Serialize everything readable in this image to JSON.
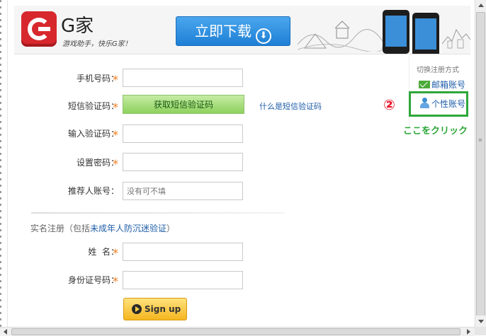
{
  "header": {
    "app_name": "G家",
    "slogan": "游戏助手，快乐G家！",
    "download_button": "立即下载",
    "download_icon": "download-icon",
    "colors": {
      "logo_red": "#d7282d",
      "download_blue": "#2b8de0"
    }
  },
  "form": {
    "phone_label": "手机号码：",
    "sms_label": "短信验证码：",
    "sms_button": "获取短信验证码",
    "sms_help_link": "什么是短信验证码",
    "code_label": "输入验证码：",
    "password_label": "设置密码：",
    "referrer_label": "推荐人账号：",
    "referrer_placeholder": "没有可不填",
    "required_mark": "*",
    "required_color": "#f07b1c"
  },
  "realname": {
    "prefix": "实名注册（包括",
    "link": "未成年人防沉迷验证",
    "suffix": "）",
    "name_label": "姓  名：",
    "id_label": "身份证号码："
  },
  "signup_button": "Sign up",
  "switch_panel": {
    "title": "切换注册方式",
    "email_option": "邮箱账号",
    "personal_option": "个性账号"
  },
  "annotation": {
    "step": "②",
    "text": "ここをクリック",
    "highlight_color": "#2ea73a"
  }
}
